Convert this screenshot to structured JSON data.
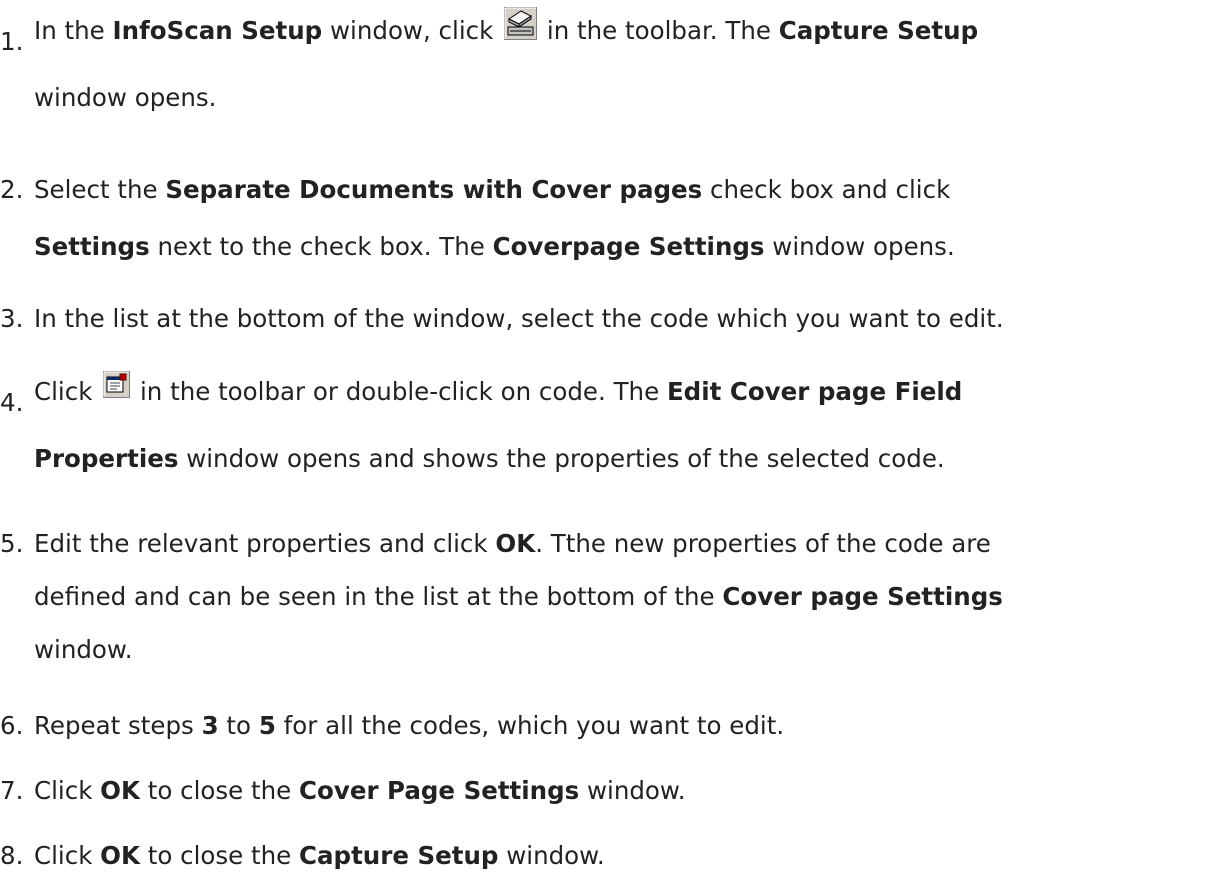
{
  "steps": [
    {
      "num": "1.",
      "t1": "In the ",
      "b1": "InfoScan Setup",
      "t2": " window, click ",
      "icon": "capture-setup-toolbar-icon",
      "t3": " in the toolbar. The ",
      "b2": "Capture Setup",
      "t4": "window opens."
    },
    {
      "num": "2.",
      "t1": "Select the ",
      "b1": "Separate Documents with Cover pages",
      "t2": " check box and click",
      "b2": "Settings",
      "t3": " next to the check box. The ",
      "b3": "Coverpage Settings",
      "t4": " window opens."
    },
    {
      "num": "3.",
      "t1": "In the list at the bottom of the window, select the code which you want to edit."
    },
    {
      "num": "4.",
      "t1": "Click ",
      "icon": "properties-toolbar-icon",
      "t2": " in the toolbar or double-click on code. The ",
      "b1": "Edit Cover page Field",
      "b2": "Properties",
      "t3": " window opens and shows the properties of the selected code."
    },
    {
      "num": "5.",
      "t1": "Edit the relevant properties and click ",
      "b1": "OK",
      "t2": ". Tthe new properties of the code are",
      "t3": "defined and can be seen in the list at the bottom of the ",
      "b2": "Cover page Settings",
      "t4": "window."
    },
    {
      "num": "6.",
      "t1": "Repeat steps ",
      "b1": "3",
      "t2": " to ",
      "b2": "5",
      "t3": " for all the codes, which you want to edit."
    },
    {
      "num": "7.",
      "t1": "Click ",
      "b1": "OK",
      "t2": " to close the ",
      "b2": "Cover Page Settings",
      "t3": " window."
    },
    {
      "num": "8.",
      "t1": "Click ",
      "b1": "OK",
      "t2": " to close the ",
      "b2": "Capture Setup",
      "t3": " window."
    }
  ]
}
